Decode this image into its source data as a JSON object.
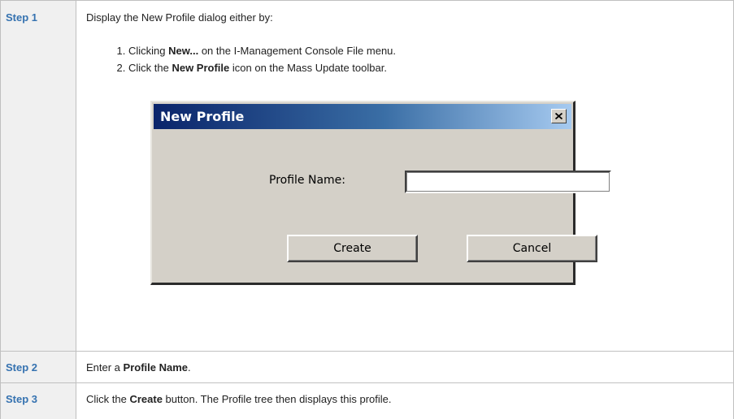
{
  "steps": [
    {
      "label": "Step 1",
      "intro": "Display the New Profile dialog either by:",
      "options": [
        {
          "before": "Clicking ",
          "bold": "New...",
          "after": " on the I-Management Console File menu."
        },
        {
          "before": "Click the ",
          "bold": "New Profile",
          "after": " icon on the Mass Update toolbar."
        }
      ]
    },
    {
      "label": "Step 2",
      "before": "Enter a ",
      "bold": "Profile Name",
      "after": "."
    },
    {
      "label": "Step 3",
      "before": "Click the ",
      "bold": "Create",
      "after": " button. The Profile tree then displays this profile."
    }
  ],
  "dialog": {
    "title": "New Profile",
    "field_label": "Profile Name:",
    "field_value": "",
    "create_label": "Create",
    "cancel_label": "Cancel",
    "close_icon": "close-icon"
  },
  "colors": {
    "step_label": "#3572b0",
    "step_cell_bg": "#f0f0f0",
    "titlebar_start": "#0a246a",
    "titlebar_end": "#a6caf0",
    "dialog_bg": "#d4d0c8"
  }
}
